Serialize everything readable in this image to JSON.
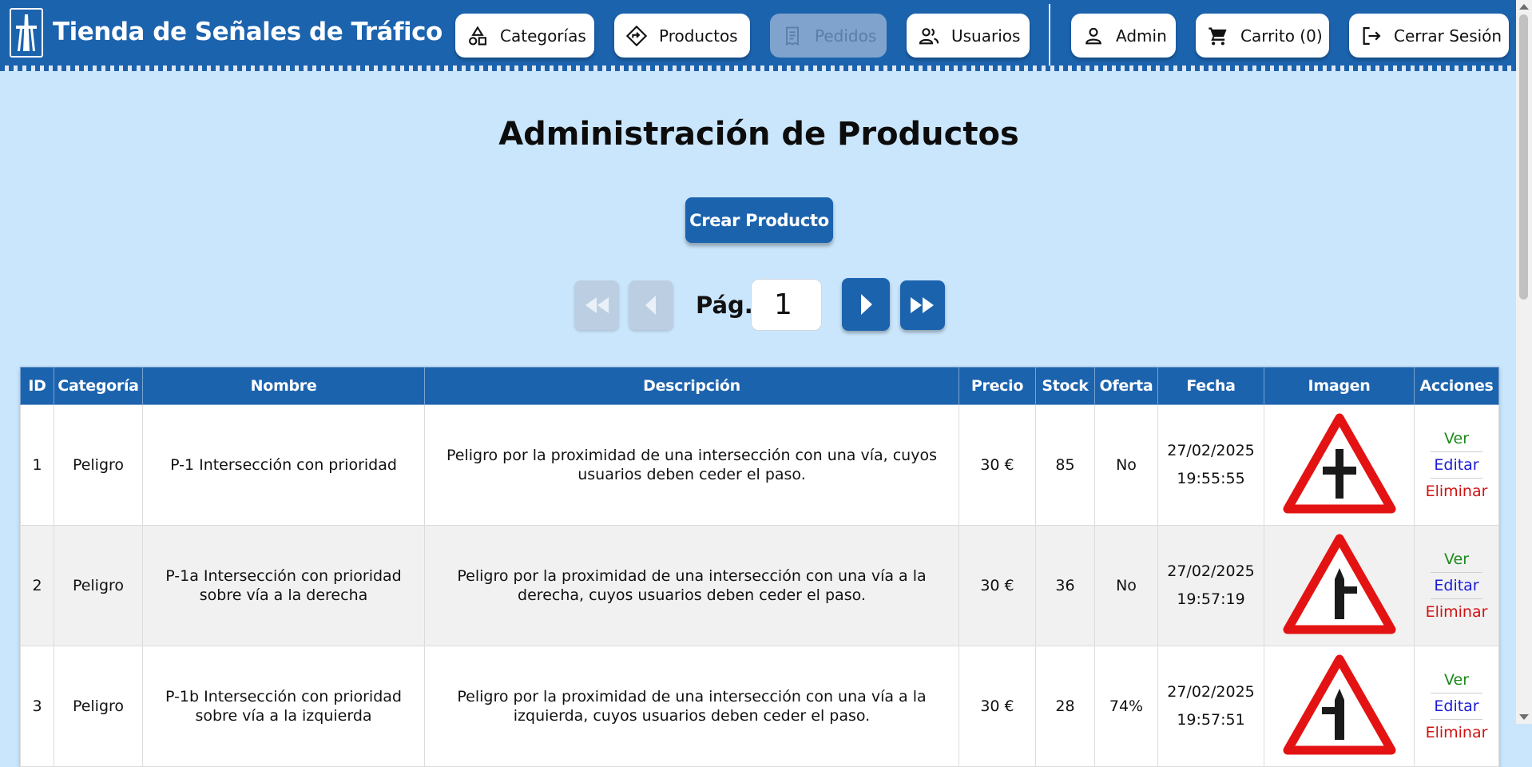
{
  "header": {
    "title": "Tienda de Señales de Tráfico",
    "nav": {
      "categorias": "Categorías",
      "productos": "Productos",
      "pedidos": "Pedidos",
      "usuarios": "Usuarios",
      "admin": "Admin",
      "carrito": "Carrito (0)",
      "cerrar": "Cerrar Sesión"
    }
  },
  "main": {
    "title": "Administración de Productos",
    "create_button": "Crear Producto",
    "pagination": {
      "label": "Pág.",
      "page": "1"
    }
  },
  "table": {
    "columns": [
      "ID",
      "Categoría",
      "Nombre",
      "Descripción",
      "Precio",
      "Stock",
      "Oferta",
      "Fecha",
      "Imagen",
      "Acciones"
    ],
    "actions": {
      "view": "Ver",
      "edit": "Editar",
      "delete": "Eliminar"
    },
    "rows": [
      {
        "id": "1",
        "category": "Peligro",
        "name": "P-1 Intersección con prioridad",
        "description": "Peligro por la proximidad de una intersección con una vía, cuyos usuarios deben ceder el paso.",
        "price": "30 €",
        "stock": "85",
        "offer": "No",
        "date": "27/02/2025",
        "time": "19:55:55",
        "sign": "cross"
      },
      {
        "id": "2",
        "category": "Peligro",
        "name": "P-1a Intersección con prioridad sobre vía a la derecha",
        "description": "Peligro por la proximidad de una intersección con una vía a la derecha, cuyos usuarios deben ceder el paso.",
        "price": "30 €",
        "stock": "36",
        "offer": "No",
        "date": "27/02/2025",
        "time": "19:57:19",
        "sign": "right"
      },
      {
        "id": "3",
        "category": "Peligro",
        "name": "P-1b Intersección con prioridad sobre vía a la izquierda",
        "description": "Peligro por la proximidad de una intersección con una vía a la izquierda, cuyos usuarios deben ceder el paso.",
        "price": "30 €",
        "stock": "28",
        "offer": "74%",
        "date": "27/02/2025",
        "time": "19:57:51",
        "sign": "left"
      }
    ]
  },
  "colors": {
    "primary": "#1c63ae",
    "background": "#cae6fc",
    "view": "#1a8a1a",
    "edit": "#1b1bd6",
    "delete": "#d11111"
  },
  "icons": [
    "road-logo-icon",
    "shapes-icon",
    "diamond-direction-icon",
    "receipt-icon",
    "users-icon",
    "user-icon",
    "cart-icon",
    "logout-icon",
    "first-page-icon",
    "prev-page-icon",
    "next-page-icon",
    "last-page-icon",
    "traffic-sign-image"
  ]
}
